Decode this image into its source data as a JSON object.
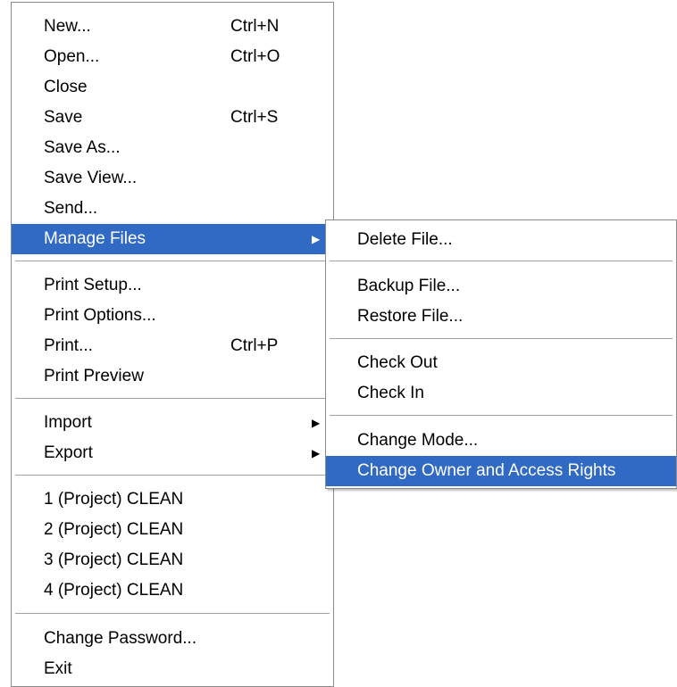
{
  "file_menu": {
    "items": [
      {
        "label": "New...",
        "shortcut": "Ctrl+N"
      },
      {
        "label": "Open...",
        "shortcut": "Ctrl+O"
      },
      {
        "label": "Close",
        "shortcut": ""
      },
      {
        "label": "Save",
        "shortcut": "Ctrl+S"
      },
      {
        "label": "Save As...",
        "shortcut": ""
      },
      {
        "label": "Save View...",
        "shortcut": ""
      },
      {
        "label": "Send...",
        "shortcut": ""
      },
      {
        "label": "Manage Files",
        "shortcut": "",
        "submenu": true,
        "highlighted": true
      },
      {
        "label": "Print Setup...",
        "shortcut": ""
      },
      {
        "label": "Print Options...",
        "shortcut": ""
      },
      {
        "label": "Print...",
        "shortcut": "Ctrl+P"
      },
      {
        "label": "Print Preview",
        "shortcut": ""
      },
      {
        "label": "Import",
        "shortcut": "",
        "submenu": true
      },
      {
        "label": "Export",
        "shortcut": "",
        "submenu": true
      },
      {
        "label": "1 (Project) CLEAN",
        "shortcut": ""
      },
      {
        "label": "2 (Project) CLEAN",
        "shortcut": ""
      },
      {
        "label": "3 (Project) CLEAN",
        "shortcut": ""
      },
      {
        "label": "4 (Project) CLEAN",
        "shortcut": ""
      },
      {
        "label": "Change Password...",
        "shortcut": ""
      },
      {
        "label": "Exit",
        "shortcut": ""
      }
    ]
  },
  "manage_files_submenu": {
    "items": [
      {
        "label": "Delete File..."
      },
      {
        "label": "Backup File..."
      },
      {
        "label": "Restore File..."
      },
      {
        "label": "Check Out"
      },
      {
        "label": "Check In"
      },
      {
        "label": "Change Mode..."
      },
      {
        "label": "Change Owner and Access Rights",
        "highlighted": true
      }
    ]
  },
  "icons": {
    "submenu_arrow": "submenu-arrow-icon"
  },
  "colors": {
    "highlight_bg": "#316ac5",
    "highlight_text": "#ffffff",
    "menu_bg": "#ffffff",
    "separator": "#a0a0a0"
  }
}
